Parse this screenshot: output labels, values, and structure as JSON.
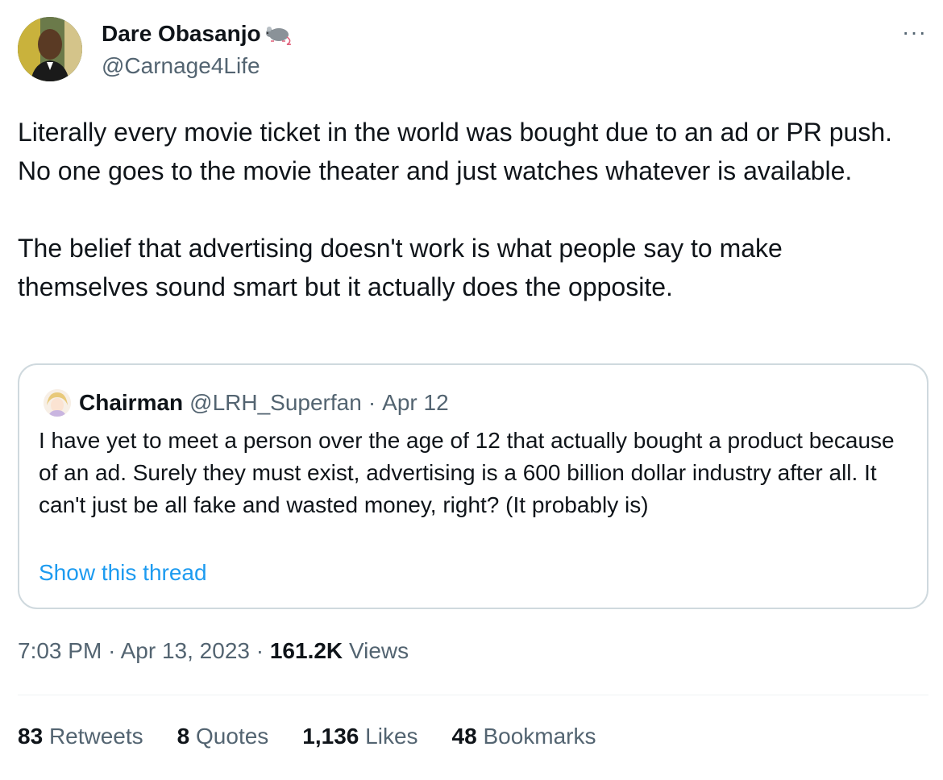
{
  "author": {
    "name": "Dare Obasanjo",
    "handle": "@Carnage4Life",
    "avatar_icon": "profile-photo",
    "badge_icon": "rat-emoji"
  },
  "tweet": {
    "paragraphs": [
      "Literally every movie ticket in the world was bought due to an ad or PR push. No one goes to the movie theater and just watches whatever is available.",
      "The belief that advertising doesn't work is what people say to make themselves sound smart but it actually does the opposite."
    ]
  },
  "quote": {
    "name": "Chairman",
    "handle": "@LRH_Superfan",
    "separator": "·",
    "date": "Apr 12",
    "text": "I have yet to meet a person over the age of 12 that actually bought a product because of an ad. Surely they must exist, advertising is a 600 billion dollar industry after all. It can't just be all fake and wasted money, right? (It probably is)",
    "show_thread": "Show this thread"
  },
  "meta": {
    "time": "7:03 PM",
    "sep1": "·",
    "date": "Apr 13, 2023",
    "sep2": "·",
    "views_count": "161.2K",
    "views_label": "Views"
  },
  "stats": {
    "retweets": {
      "num": "83",
      "label": "Retweets"
    },
    "quotes": {
      "num": "8",
      "label": "Quotes"
    },
    "likes": {
      "num": "1,136",
      "label": "Likes"
    },
    "bookmarks": {
      "num": "48",
      "label": "Bookmarks"
    }
  },
  "colors": {
    "text": "#0f1419",
    "secondary": "#536471",
    "link": "#1d9bf0",
    "border": "#cfd9de"
  }
}
